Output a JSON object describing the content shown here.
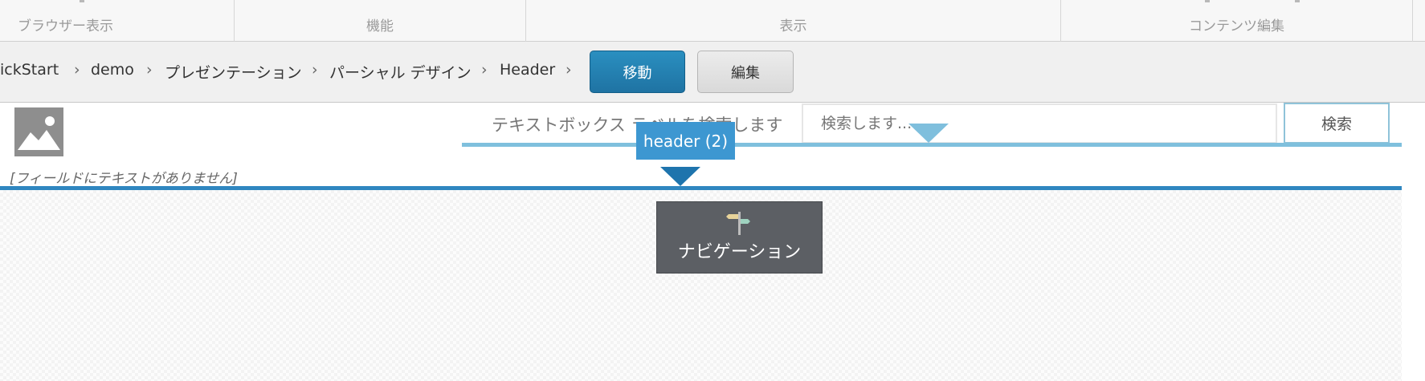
{
  "ribbon": {
    "groups": [
      {
        "label": "ブラウザー表示"
      },
      {
        "label": "機能"
      },
      {
        "label": "表示"
      },
      {
        "label": "コンテンツ編集"
      }
    ]
  },
  "breadcrumb": {
    "items": [
      "ickStart",
      "demo",
      "プレゼンテーション",
      "パーシャル デザイン",
      "Header"
    ],
    "separator": "›"
  },
  "actions": {
    "move_label": "移動",
    "edit_label": "編集"
  },
  "header_area": {
    "empty_field_text": "[フィールドにテキストがありません]",
    "search_label": "テキストボックス ラベルを検索します",
    "search_placeholder": "検索します...",
    "search_button": "検索",
    "placeholder_tag": "header (2)"
  },
  "rendering": {
    "navigation_label": "ナビゲーション"
  },
  "colors": {
    "accent_blue": "#2f86c0",
    "light_blue": "#7fc0dd",
    "button_blue": "#1f73a3",
    "nav_block": "#5c5f64"
  }
}
